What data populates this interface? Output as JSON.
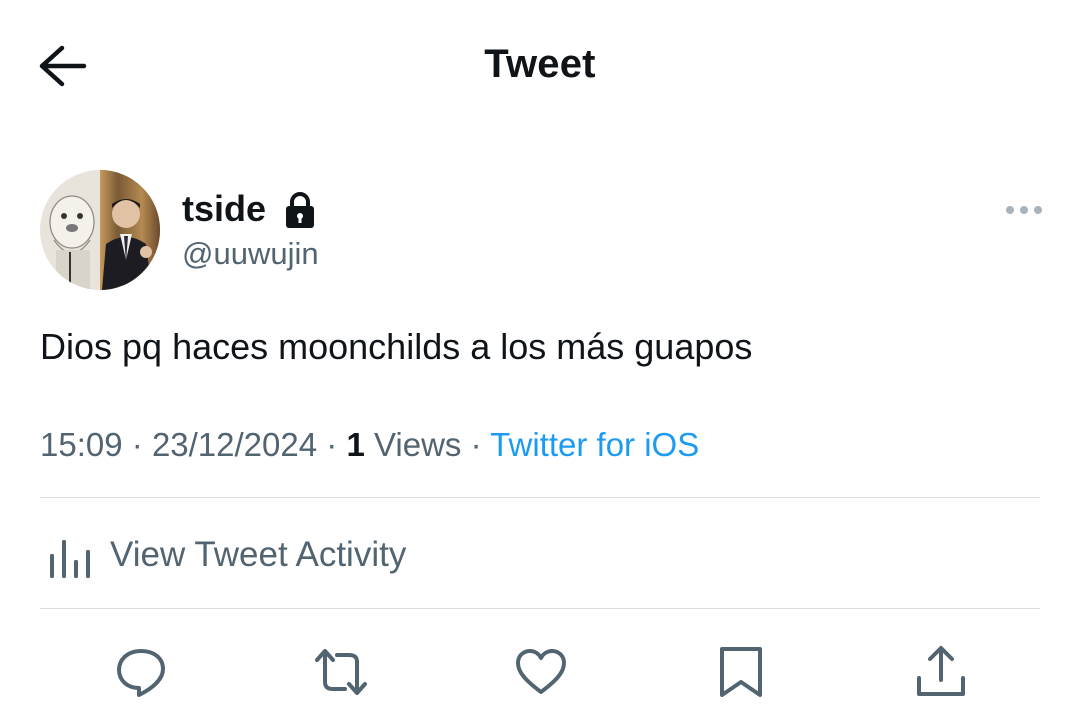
{
  "header": {
    "title": "Tweet",
    "back_icon": "arrow-left-icon"
  },
  "author": {
    "display_name": "tside",
    "handle": "@uuwujin",
    "protected_icon": "lock-icon"
  },
  "tweet": {
    "text": "Dios pq haces moonchilds a los más guapos",
    "time": "15:09",
    "date": "23/12/2024",
    "views_count": "1",
    "views_label": "Views",
    "source": "Twitter for iOS",
    "separator": "·"
  },
  "activity": {
    "label": "View Tweet Activity",
    "icon": "bar-chart-icon"
  },
  "actions": [
    {
      "name": "reply",
      "icon": "reply-icon"
    },
    {
      "name": "retweet",
      "icon": "retweet-icon"
    },
    {
      "name": "like",
      "icon": "heart-icon"
    },
    {
      "name": "bookmark",
      "icon": "bookmark-icon"
    },
    {
      "name": "share",
      "icon": "share-icon"
    }
  ],
  "colors": {
    "text": "#0f1419",
    "secondary": "#536471",
    "accent": "#1d9bf0",
    "divider": "#d7dee3"
  }
}
